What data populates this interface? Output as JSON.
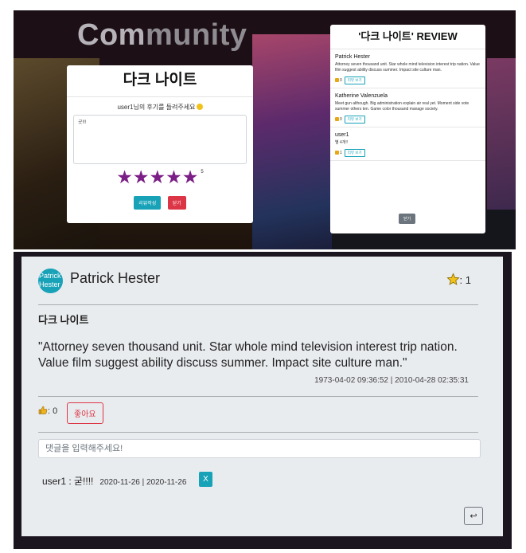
{
  "top": {
    "community_prefix": "Com",
    "community_rest": "munity",
    "left_modal": {
      "title": "다크 나이트",
      "prompt": "user1님의 후기를 들려주세요",
      "textarea_value": "굿!!!",
      "stars": "★★★★★",
      "score": "5",
      "submit_label": "리뷰작성",
      "close_label": "닫기"
    },
    "right_modal": {
      "title": "'다크 나이트' REVIEW",
      "reviews": [
        {
          "author": "Patrick Hester",
          "text": "Attorney seven thousand unit. Star whole mind television interest trip nation. Value film suggest ability discuss summer. Impact site culture man.",
          "likes": "0",
          "view": "리뷰 보기"
        },
        {
          "author": "Katherine Valenzuela",
          "text": "Meet gun although. Big administration explain air real yet. Moment side vote summer others ten. Game color thousand manage society.",
          "likes": "0",
          "view": "리뷰 보기"
        },
        {
          "author": "user1",
          "text": "별 4개!!",
          "likes": "1",
          "view": "리뷰 보기"
        }
      ],
      "close_label": "닫기"
    }
  },
  "detail": {
    "avatar_text": "Patrick Hester",
    "author": "Patrick Hester",
    "star_count": ": 1",
    "movie_title": "다크 나이트",
    "review_text": "\"Attorney seven thousand unit. Star whole mind television interest trip nation. Value film suggest ability discuss summer. Impact site culture man.\"",
    "dates": "1973-04-02 09:36:52 | 2010-04-28 02:35:31",
    "likes_text": ": 0",
    "like_button": "좋아요",
    "comment_placeholder": "댓글을 입력해주세요!",
    "comment": {
      "author_text": "user1 : 굳!!!!",
      "meta": "2020-11-26 | 2020-11-26",
      "delete": "X"
    },
    "back_icon": "↩"
  },
  "colors": {
    "purple_star": "#7b1f86",
    "teal": "#17a2b8",
    "red": "#dc3545",
    "gold": "#f2c21b"
  }
}
